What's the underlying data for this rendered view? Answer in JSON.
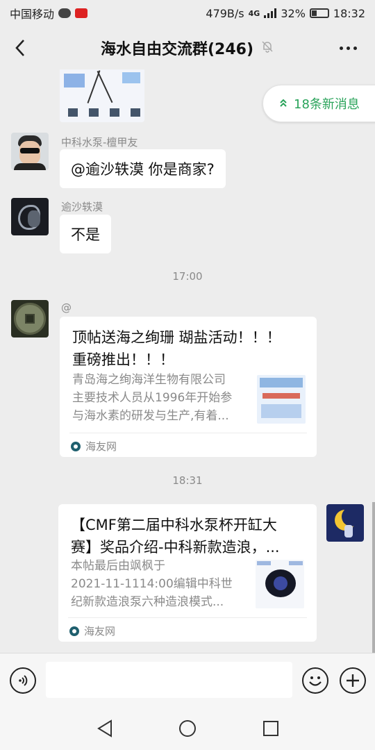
{
  "status_bar": {
    "carrier": "中国移动",
    "network_speed": "479B/s",
    "network_type": "4G",
    "battery": "32%",
    "battery_level": 0.32,
    "time": "18:32"
  },
  "header": {
    "title": "海水自由交流群(246)",
    "back_icon": "chevron-left-icon",
    "mute_icon": "bell-off-icon",
    "more_icon": "more-dots-icon"
  },
  "new_messages_pill": {
    "label": "18条新消息",
    "color": "#29a35a"
  },
  "messages": [
    {
      "sender": "中科水泵-檀甲友",
      "text": "@逾沙轶漠  你是商家?"
    },
    {
      "sender": "逾沙轶漠",
      "text": "不是"
    }
  ],
  "timestamps": [
    "17:00",
    "18:31"
  ],
  "link_cards": [
    {
      "sender": "@",
      "title": "顶帖送海之绚珊 瑚盐活动！！！重磅推出！！！",
      "title_line1": "顶帖送海之绚珊 瑚盐活动！！！",
      "title_line2": "重磅推出！！！",
      "desc_line1": "青岛海之绚海洋生物有限公司",
      "desc_line2": "主要技术人员从1996年开始参",
      "desc_line3": "与海水素的研发与生产,有着...",
      "source": "海友网"
    },
    {
      "title_line1": "【CMF第二届中科水泵杯开缸大",
      "title_line2": "赛】奖品介绍-中科新款造浪，...",
      "desc_line1": "本帖最后由飒枫于",
      "desc_line2": "2021-11-1114:00编辑中科世",
      "desc_line3": "纪新款造浪泵六种造浪模式...",
      "source": "海友网"
    }
  ],
  "input_bar": {
    "value": "",
    "voice_icon": "voice-icon",
    "emoji_icon": "emoji-icon",
    "plus_icon": "plus-icon"
  },
  "system_nav": {
    "back_icon": "nav-back-icon",
    "home_icon": "nav-home-icon",
    "recent_icon": "nav-recent-icon"
  },
  "colors": {
    "chat_background": "#ededed",
    "bubble": "#ffffff",
    "accent_green": "#29a35a"
  }
}
